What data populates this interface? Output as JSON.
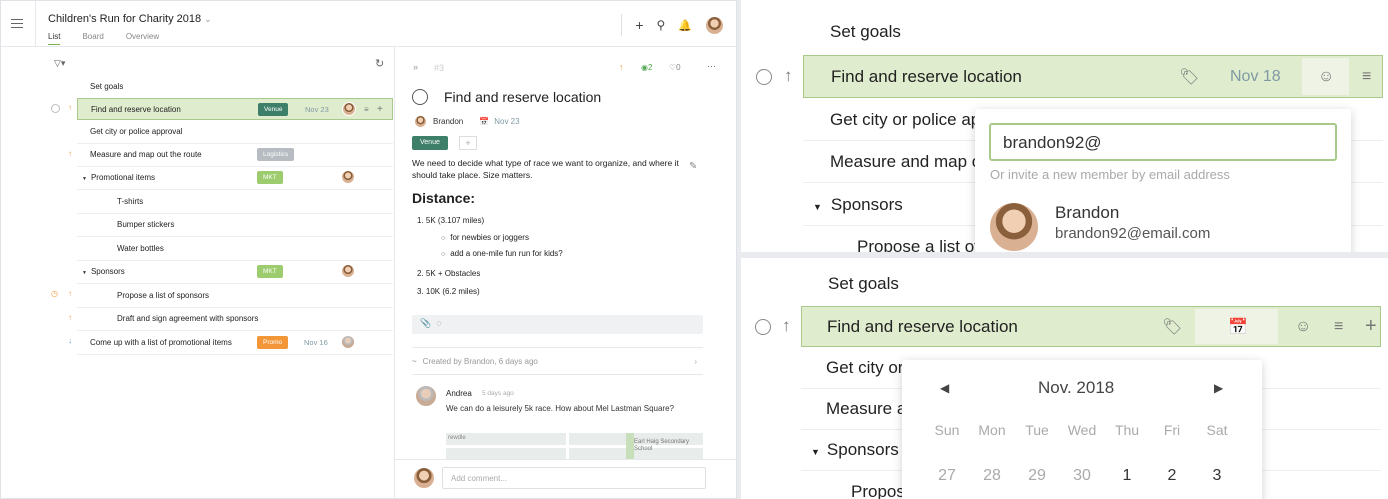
{
  "project": {
    "title": "Children's Run for Charity 2018",
    "tabs": [
      "List",
      "Board",
      "Overview"
    ]
  },
  "tasks": [
    {
      "title": "Set goals"
    },
    {
      "title": "Find and reserve location",
      "tag": "Venue",
      "date": "Nov 23"
    },
    {
      "title": "Get city or police approval"
    },
    {
      "title": "Measure and map out the route",
      "tag": "Logistics"
    },
    {
      "title": "Promotional items",
      "tag": "MKT"
    },
    {
      "title": "T-shirts"
    },
    {
      "title": "Bumper stickers"
    },
    {
      "title": "Water bottles"
    },
    {
      "title": "Sponsors",
      "tag": "MKT"
    },
    {
      "title": "Propose a list of sponsors"
    },
    {
      "title": "Draft and sign agreement with sponsors"
    },
    {
      "title": "Come up with a list of promotional items",
      "tag": "Promo",
      "date": "Nov 16"
    }
  ],
  "detail": {
    "id": "#3",
    "views": "2",
    "likes": "0",
    "title": "Find and reserve location",
    "assignee": "Brandon",
    "date": "Nov 23",
    "tag": "Venue",
    "description": "We need to decide what type of race we want to organize, and where it should take place. Size matters.",
    "heading": "Distance:",
    "list": [
      "1. 5K (3.107 miles)",
      "for newbies or joggers",
      "add a one-mile fun run for kids?",
      "2. 5K + Obstacles",
      "3. 10K (6.2 miles)"
    ],
    "history": "Created by Brandon, 6 days ago",
    "comment": {
      "author": "Andrea",
      "time": "5 days ago",
      "text": "We can do a leisurely 5k race. How about Mel Lastman Square?",
      "map_text1": "rewdle",
      "map_text2": "Earl Haig Secondary School"
    },
    "comment_placeholder": "Add comment..."
  },
  "zoom_top": {
    "rows": [
      "Set goals",
      "Find and reserve location",
      "Get city or police ap",
      "Measure and map o",
      "Sponsors",
      "Propose a list of"
    ],
    "date": "Nov 18",
    "input_value": "brandon92@",
    "hint": "Or invite a new member by email address",
    "member_name": "Brandon",
    "member_email": "brandon92@email.com"
  },
  "zoom_bottom": {
    "rows": [
      "Set goals",
      "Find and reserve location",
      "Get city or",
      "Measure a",
      "Sponsors",
      "Propos"
    ],
    "month": "Nov. 2018",
    "weekdays": [
      "Sun",
      "Mon",
      "Tue",
      "Wed",
      "Thu",
      "Fri",
      "Sat"
    ],
    "days": [
      "27",
      "28",
      "29",
      "30",
      "1",
      "2",
      "3"
    ]
  }
}
